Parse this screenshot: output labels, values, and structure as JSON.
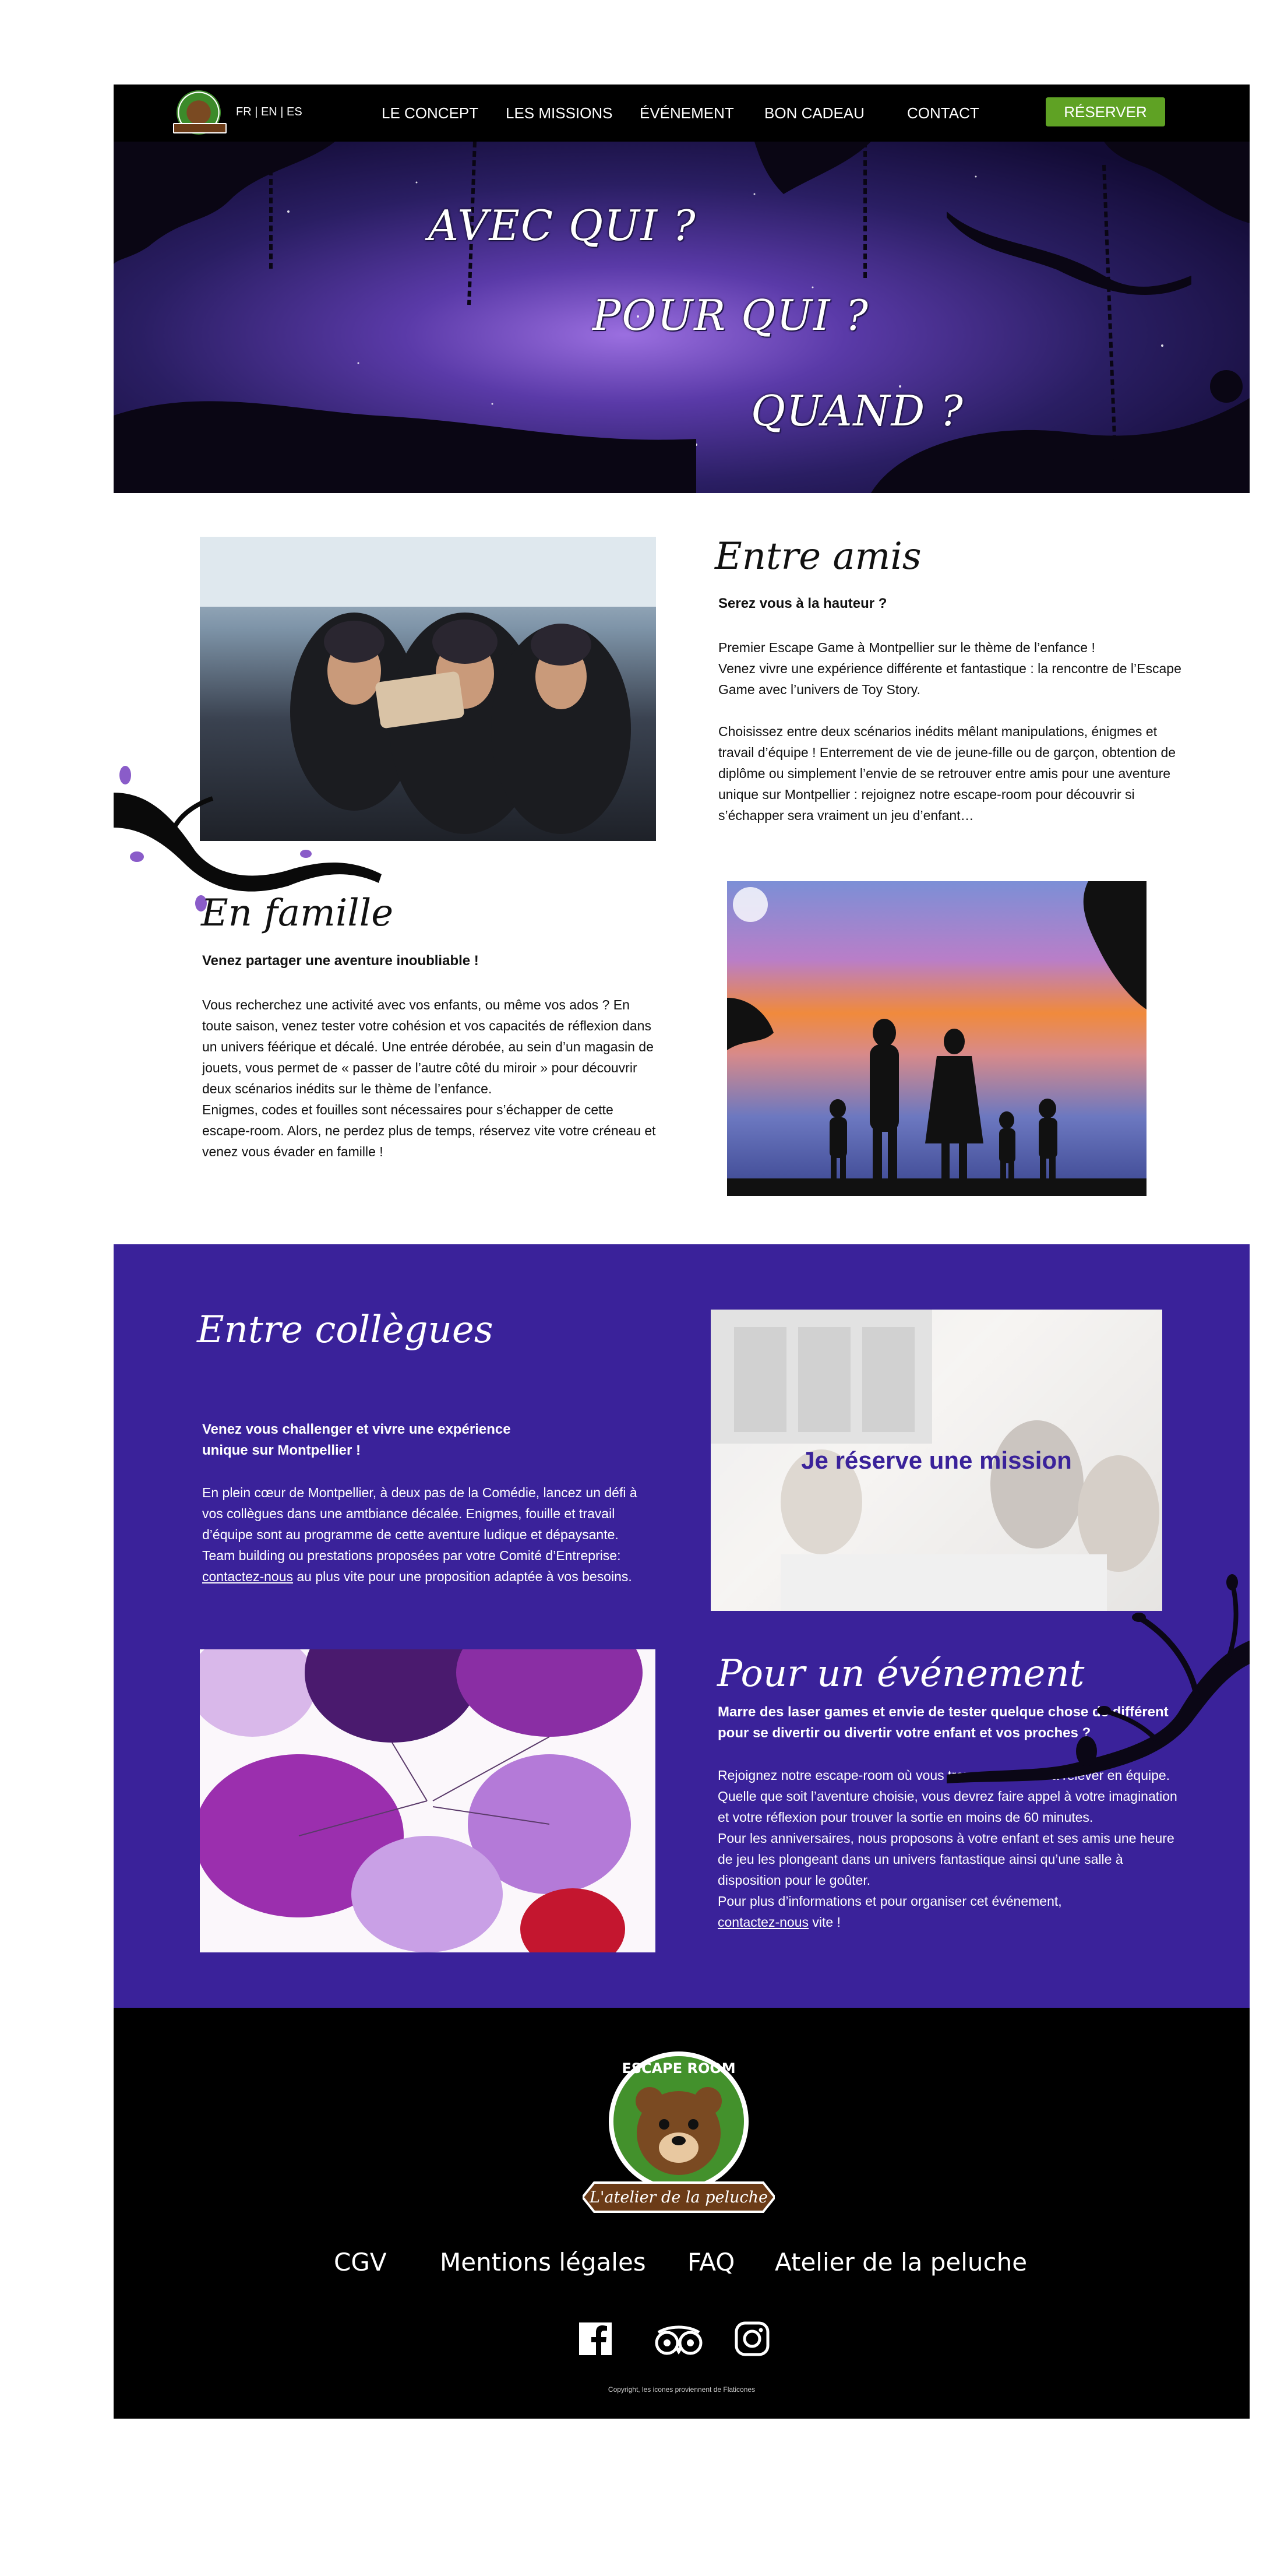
{
  "nav": {
    "languages": "FR | EN | ES",
    "links": [
      "LE CONCEPT",
      "LES MISSIONS",
      "ÉVÉNEMENT",
      "BON CADEAU",
      "CONTACT"
    ],
    "reserve_label": "RÉSERVER"
  },
  "hero": {
    "line1": "AVEC QUI ?",
    "line2": "POUR QUI ?",
    "line3": "QUAND ?"
  },
  "amis": {
    "title": "Entre amis",
    "lead": "Serez vous à la hauteur ?",
    "p1a": "Premier Escape Game à Montpellier sur le thème de l’enfance !",
    "p1b": "Venez vivre une expérience différente et fantastique : la rencontre de l’Escape Game avec l’univers de Toy Story.",
    "p2": "Choisissez entre deux scénarios inédits mêlant manipulations, énigmes et travail d’équipe ! Enterrement de vie de jeune-fille ou de garçon, obtention de diplôme ou simplement l’envie de se retrouver entre amis pour une aventure unique sur Montpellier : rejoignez notre escape-room pour découvrir si s’échapper sera vraiment un jeu d’enfant…"
  },
  "famille": {
    "title": "En famille",
    "lead": "Venez partager une aventure inoubliable !",
    "p1": "Vous recherchez une activité avec vos enfants, ou même vos ados ? En toute saison, venez tester votre cohésion et vos capacités de réflexion dans un univers féérique et décalé. Une entrée dérobée, au sein d’un magasin de jouets, vous permet de « passer de l’autre côté du miroir » pour découvrir deux scénarios inédits sur le thème de l’enfance.",
    "p2": "Enigmes, codes et fouilles sont nécessaires pour s’échapper de cette escape-room. Alors, ne perdez plus de temps, réservez vite votre créneau et venez vous évader en famille !"
  },
  "collegues": {
    "title": "Entre collègues",
    "lead": "Venez vous challenger et vivre une expérience unique sur Montpellier !",
    "p1_before": "En plein cœur de Montpellier, à deux pas de la Comédie, lancez un défi à vos collègues dans une amtbiance décalée. Enigmes, fouille et travail d’équipe sont au programme de cette aventure ludique et dépaysante. Team building ou prestations proposées par votre Comité d’Entreprise: ",
    "p1_link": "contactez-nous",
    "p1_after": " au plus vite pour une proposition adaptée à vos besoins.",
    "cta": "Je réserve une mission"
  },
  "evenement": {
    "title": "Pour un événement",
    "lead": "Marre des laser games et envie de tester quelque chose de différent pour se divertir ou divertir votre enfant et vos proches ?",
    "p1": "Rejoignez notre escape-room où vous trouverez un défi à relever en équipe. Quelle que soit l’aventure choisie, vous devrez faire appel à votre imagination et votre réflexion pour trouver la sortie en moins de 60 minutes.",
    "p2": "Pour les anniversaires, nous proposons à votre enfant et ses amis une heure de jeu les plongeant dans un univers fantastique ainsi qu’une salle à disposition pour le goûter.",
    "p3": "Pour plus d’informations et pour organiser cet événement,",
    "p3_link": "contactez-nous",
    "p3_after": " vite !"
  },
  "footer": {
    "logo_top": "ESCAPE ROOM",
    "logo_bottom": "L'atelier de la peluche",
    "links": [
      "CGV",
      "Mentions légales",
      "FAQ",
      "Atelier de la peluche"
    ],
    "social_icons": [
      "facebook-icon",
      "tripadvisor-icon",
      "instagram-icon"
    ],
    "copyright": "Copyright, les icones proviennent de Flaticones"
  },
  "colors": {
    "nav_bg": "#000000",
    "reserve_bg": "#5fa224",
    "purple_bg": "#3a229a",
    "cta_text": "#3a229a"
  }
}
